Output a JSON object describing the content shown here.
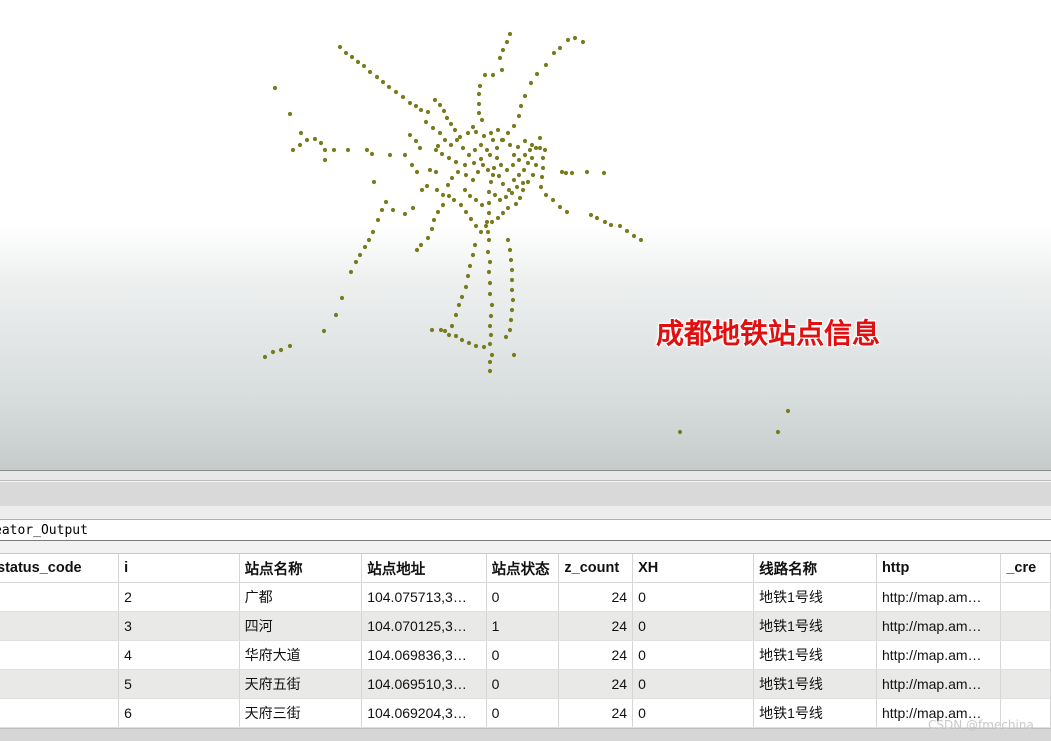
{
  "map": {
    "title": "成都地铁站点信息",
    "point_color": "#7a7a1e",
    "point_icon": "station-point-icon"
  },
  "layer": {
    "name": "eator_Output"
  },
  "table": {
    "columns": [
      "status_code",
      "i",
      "站点名称",
      "站点地址",
      "站点状态",
      "z_count",
      "XH",
      "线路名称",
      "http",
      "_cre"
    ],
    "rows": [
      {
        "status_code": "",
        "i": "2",
        "name": "广都",
        "addr": "104.075713,3…",
        "state": "0",
        "z_count": "24",
        "xh": "0",
        "line": "地铁1号线",
        "http": "http://map.am…",
        "cre": ""
      },
      {
        "status_code": "",
        "i": "3",
        "name": "四河",
        "addr": "104.070125,3…",
        "state": "1",
        "z_count": "24",
        "xh": "0",
        "line": "地铁1号线",
        "http": "http://map.am…",
        "cre": ""
      },
      {
        "status_code": "",
        "i": "4",
        "name": "华府大道",
        "addr": "104.069836,3…",
        "state": "0",
        "z_count": "24",
        "xh": "0",
        "line": "地铁1号线",
        "http": "http://map.am…",
        "cre": ""
      },
      {
        "status_code": "",
        "i": "5",
        "name": "天府五街",
        "addr": "104.069510,3…",
        "state": "0",
        "z_count": "24",
        "xh": "0",
        "line": "地铁1号线",
        "http": "http://map.am…",
        "cre": ""
      },
      {
        "status_code": "",
        "i": "6",
        "name": "天府三街",
        "addr": "104.069204,3…",
        "state": "0",
        "z_count": "24",
        "xh": "0",
        "line": "地铁1号线",
        "http": "http://map.am…",
        "cre": ""
      }
    ]
  },
  "watermark": "CSDN @fmechina"
}
